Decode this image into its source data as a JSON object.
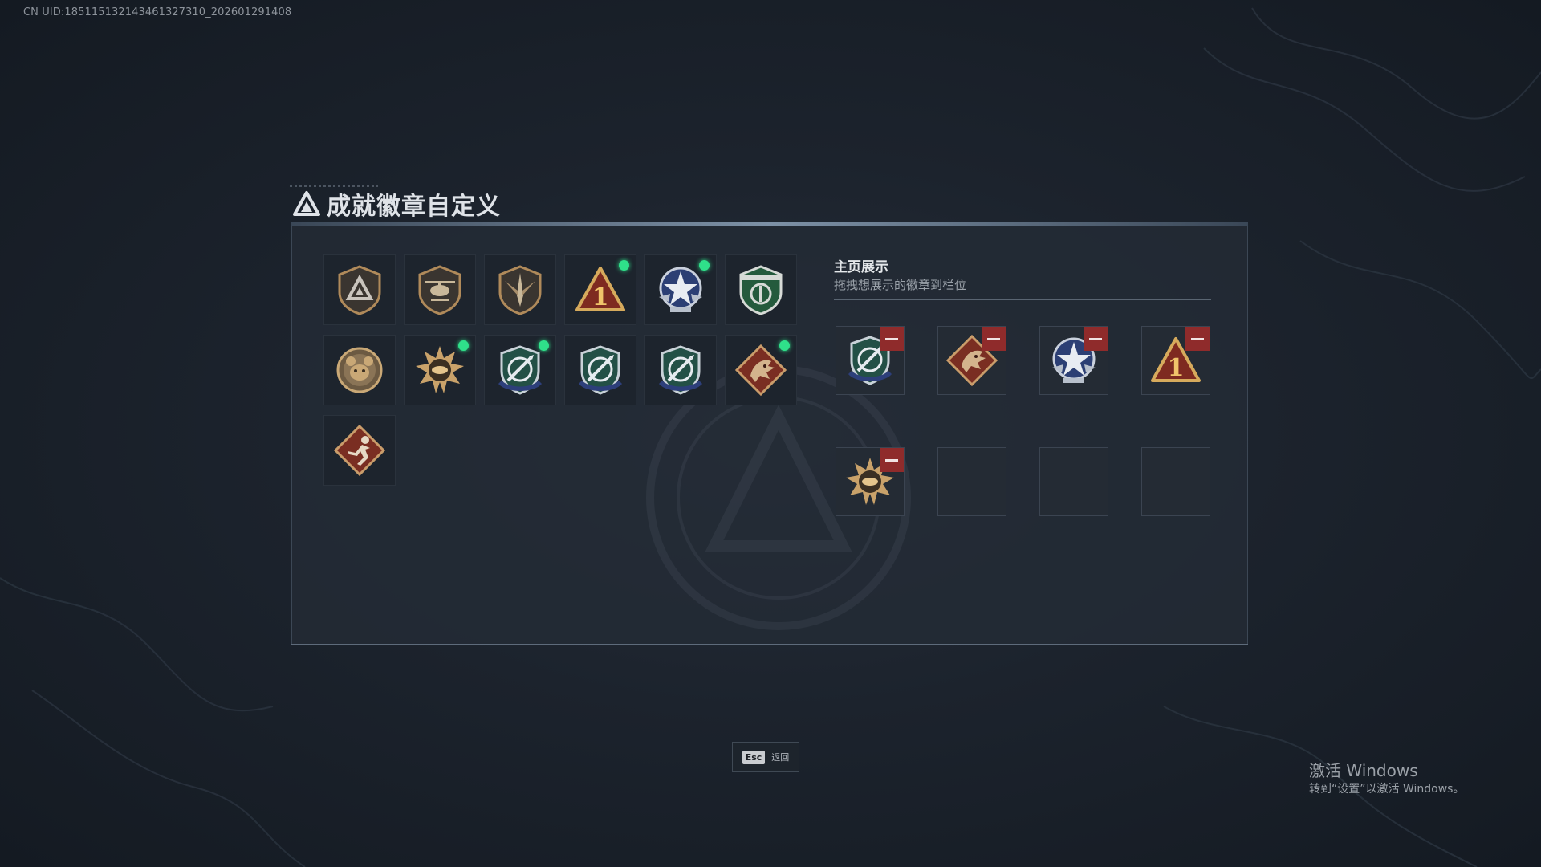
{
  "uid_text": "CN UID:185115132143461327310_202601291408",
  "title": "成就徽章自定义",
  "showcase": {
    "title": "主页展示",
    "subtitle": "拖拽想展示的徽章到栏位"
  },
  "badges": [
    {
      "icon": "triangle-shield-badge-icon",
      "is_new": false
    },
    {
      "icon": "helicopter-shield-badge-icon",
      "is_new": false
    },
    {
      "icon": "winged-dagger-badge-icon",
      "is_new": false
    },
    {
      "icon": "number-one-triangle-badge-icon",
      "is_new": true
    },
    {
      "icon": "star-wings-badge-icon",
      "is_new": true
    },
    {
      "icon": "green-medic-shield-badge-icon",
      "is_new": false
    },
    {
      "icon": "bear-head-badge-icon",
      "is_new": false
    },
    {
      "icon": "sun-burst-badge-icon",
      "is_new": true
    },
    {
      "icon": "missile-shield-badge-icon",
      "is_new": true
    },
    {
      "icon": "missile-shield-badge-icon",
      "is_new": false
    },
    {
      "icon": "missile-shield-badge-icon",
      "is_new": false
    },
    {
      "icon": "dragon-diamond-badge-icon",
      "is_new": true
    },
    {
      "icon": "runner-diamond-badge-icon",
      "is_new": false
    }
  ],
  "slots": [
    {
      "icon": "missile-shield-badge-icon",
      "filled": true
    },
    {
      "icon": "dragon-diamond-badge-icon",
      "filled": true
    },
    {
      "icon": "star-wings-badge-icon",
      "filled": true
    },
    {
      "icon": "number-one-triangle-badge-icon",
      "filled": true
    },
    {
      "icon": "sun-burst-badge-icon",
      "filled": true
    },
    {
      "icon": "",
      "filled": false
    },
    {
      "icon": "",
      "filled": false
    },
    {
      "icon": "",
      "filled": false
    }
  ],
  "esc": {
    "key": "Esc",
    "label": "返回"
  },
  "watermark": {
    "line1": "激活 Windows",
    "line2": "转到“设置”以激活 Windows。"
  },
  "colors": {
    "new_dot": "#2fe08a",
    "remove": "#8f2b2b",
    "bronze": "#b08a5a",
    "panel": "#242c36"
  }
}
